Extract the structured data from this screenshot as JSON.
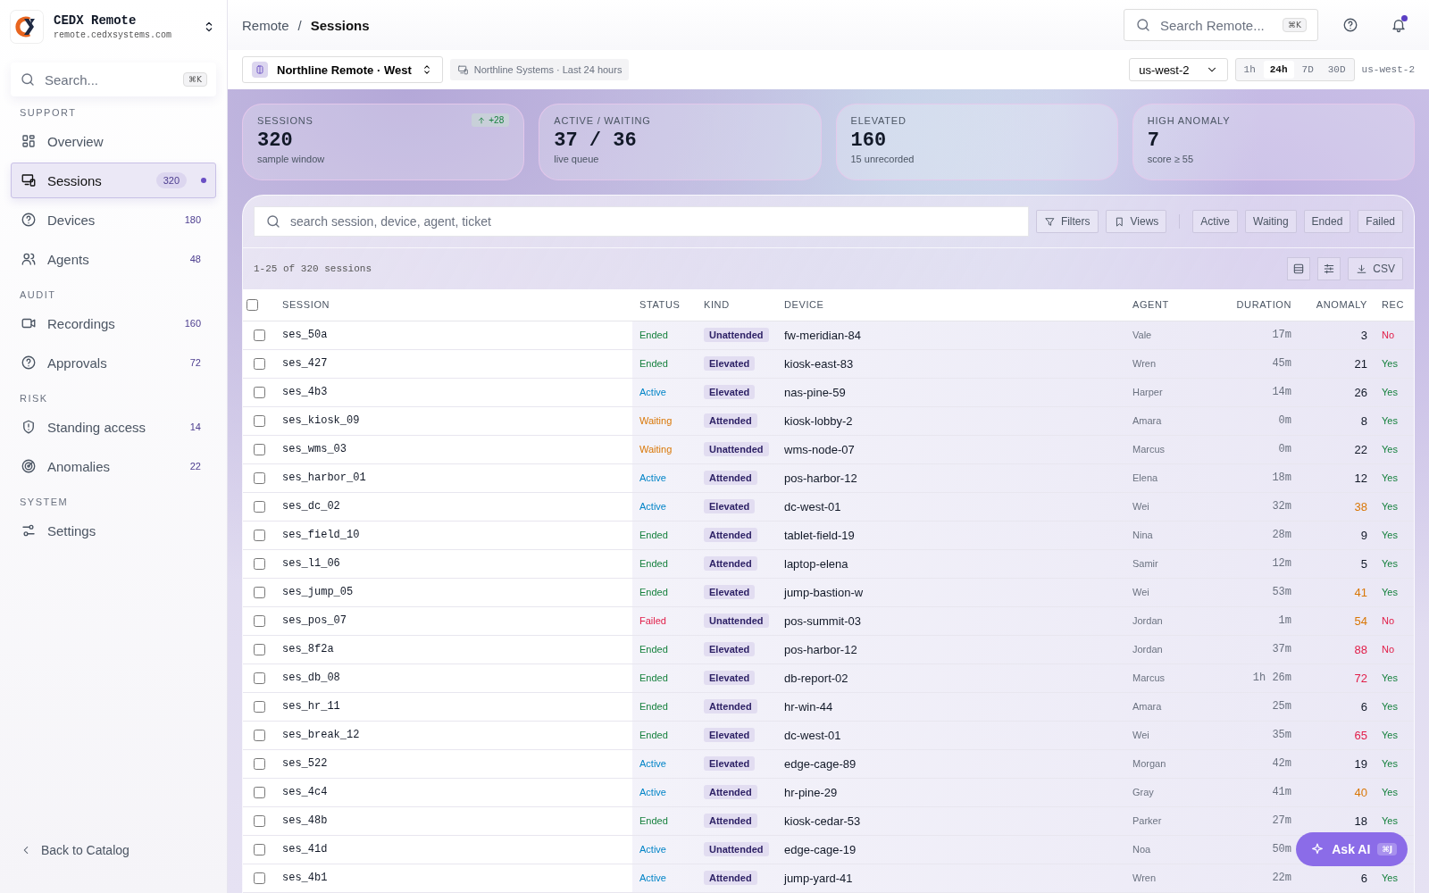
{
  "brand": {
    "title": "CEDX Remote",
    "subtitle": "remote.cedxsystems.com"
  },
  "sidebar": {
    "search": {
      "placeholder": "Search...",
      "shortcut": "⌘K"
    },
    "sections": [
      {
        "title": "SUPPORT",
        "items": [
          {
            "label": "Overview",
            "selected": false,
            "dot": false
          },
          {
            "label": "Sessions",
            "count": "320",
            "selected": true,
            "dot": true
          },
          {
            "label": "Devices",
            "count": "180",
            "selected": false,
            "dot": false
          },
          {
            "label": "Agents",
            "count": "48",
            "selected": false,
            "dot": false
          }
        ]
      },
      {
        "title": "AUDIT",
        "items": [
          {
            "label": "Recordings",
            "count": "160",
            "selected": false,
            "dot": false
          },
          {
            "label": "Approvals",
            "count": "72",
            "selected": false,
            "dot": false
          }
        ]
      },
      {
        "title": "RISK",
        "items": [
          {
            "label": "Standing access",
            "count": "14",
            "selected": false,
            "dot": false
          },
          {
            "label": "Anomalies",
            "count": "22",
            "selected": false,
            "dot": false
          }
        ]
      },
      {
        "title": "SYSTEM",
        "items": [
          {
            "label": "Settings",
            "selected": false,
            "dot": false
          }
        ]
      }
    ],
    "back": "Back to Catalog"
  },
  "header": {
    "breadcrumb": [
      "Remote",
      "Sessions"
    ],
    "breadcrumb_separator": "/",
    "search": {
      "placeholder": "Search Remote...",
      "shortcut": "⌘K"
    },
    "notifications_unread": true
  },
  "toolbar": {
    "workspace": "Northline Remote · West",
    "context": "Northline Systems · Last 24 hours",
    "region": "us-west-2",
    "ranges": [
      {
        "label": "1h",
        "selected": false
      },
      {
        "label": "24h",
        "selected": true
      },
      {
        "label": "7D",
        "selected": false
      },
      {
        "label": "30D",
        "selected": false
      }
    ],
    "region_label": "us-west-2"
  },
  "kpis": [
    {
      "label": "SESSIONS",
      "value": "320",
      "note": "sample window",
      "delta": "+28"
    },
    {
      "label": "ACTIVE / WAITING",
      "value": "37 / 36",
      "note": "live queue"
    },
    {
      "label": "ELEVATED",
      "value": "160",
      "note": "15 unrecorded"
    },
    {
      "label": "HIGH ANOMALY",
      "value": "7",
      "note": "score ≥ 55"
    }
  ],
  "table": {
    "search": {
      "placeholder": "search session, device, agent, ticket"
    },
    "buttons": [
      "Filters",
      "Views"
    ],
    "status_filters": [
      {
        "label": "Active",
        "selected": false
      },
      {
        "label": "Waiting",
        "selected": false
      },
      {
        "label": "Ended",
        "selected": false
      },
      {
        "label": "Failed",
        "selected": false
      }
    ],
    "count": "1-25 of 320 sessions",
    "export": "CSV",
    "all_selected": false,
    "columns": [
      "SESSION",
      "STATUS",
      "KIND",
      "DEVICE",
      "AGENT",
      "DURATION",
      "ANOMALY",
      "REC"
    ],
    "rows": [
      {
        "session": "ses_50a",
        "status": {
          "text": "Ended",
          "color": "#15803d"
        },
        "kind": "Unattended",
        "device": "fw-meridian-84",
        "agent": "Vale",
        "duration": "17m",
        "anomaly": {
          "text": "3",
          "color": "#111827"
        },
        "rec": "No",
        "recorded": false,
        "selected": false
      },
      {
        "session": "ses_427",
        "status": {
          "text": "Ended",
          "color": "#15803d"
        },
        "kind": "Elevated",
        "device": "kiosk-east-83",
        "agent": "Wren",
        "duration": "45m",
        "anomaly": {
          "text": "21",
          "color": "#111827"
        },
        "rec": "Yes",
        "recorded": true,
        "selected": false
      },
      {
        "session": "ses_4b3",
        "status": {
          "text": "Active",
          "color": "#0284c7"
        },
        "kind": "Elevated",
        "device": "nas-pine-59",
        "agent": "Harper",
        "duration": "14m",
        "anomaly": {
          "text": "26",
          "color": "#111827"
        },
        "rec": "Yes",
        "recorded": true,
        "selected": false
      },
      {
        "session": "ses_kiosk_09",
        "status": {
          "text": "Waiting",
          "color": "#d97706"
        },
        "kind": "Attended",
        "device": "kiosk-lobby-2",
        "agent": "Amara",
        "duration": "0m",
        "anomaly": {
          "text": "8",
          "color": "#111827"
        },
        "rec": "Yes",
        "recorded": true,
        "selected": false
      },
      {
        "session": "ses_wms_03",
        "status": {
          "text": "Waiting",
          "color": "#d97706"
        },
        "kind": "Unattended",
        "device": "wms-node-07",
        "agent": "Marcus",
        "duration": "0m",
        "anomaly": {
          "text": "22",
          "color": "#111827"
        },
        "rec": "Yes",
        "recorded": true,
        "selected": false
      },
      {
        "session": "ses_harbor_01",
        "status": {
          "text": "Active",
          "color": "#0284c7"
        },
        "kind": "Attended",
        "device": "pos-harbor-12",
        "agent": "Elena",
        "duration": "18m",
        "anomaly": {
          "text": "12",
          "color": "#111827"
        },
        "rec": "Yes",
        "recorded": true,
        "selected": false
      },
      {
        "session": "ses_dc_02",
        "status": {
          "text": "Active",
          "color": "#0284c7"
        },
        "kind": "Elevated",
        "device": "dc-west-01",
        "agent": "Wei",
        "duration": "32m",
        "anomaly": {
          "text": "38",
          "color": "#d97706"
        },
        "rec": "Yes",
        "recorded": true,
        "selected": false
      },
      {
        "session": "ses_field_10",
        "status": {
          "text": "Ended",
          "color": "#15803d"
        },
        "kind": "Attended",
        "device": "tablet-field-19",
        "agent": "Nina",
        "duration": "28m",
        "anomaly": {
          "text": "9",
          "color": "#111827"
        },
        "rec": "Yes",
        "recorded": true,
        "selected": false
      },
      {
        "session": "ses_l1_06",
        "status": {
          "text": "Ended",
          "color": "#15803d"
        },
        "kind": "Attended",
        "device": "laptop-elena",
        "agent": "Samir",
        "duration": "12m",
        "anomaly": {
          "text": "5",
          "color": "#111827"
        },
        "rec": "Yes",
        "recorded": true,
        "selected": false
      },
      {
        "session": "ses_jump_05",
        "status": {
          "text": "Ended",
          "color": "#15803d"
        },
        "kind": "Elevated",
        "device": "jump-bastion-w",
        "agent": "Wei",
        "duration": "53m",
        "anomaly": {
          "text": "41",
          "color": "#d97706"
        },
        "rec": "Yes",
        "recorded": true,
        "selected": false
      },
      {
        "session": "ses_pos_07",
        "status": {
          "text": "Failed",
          "color": "#e11d48"
        },
        "kind": "Unattended",
        "device": "pos-summit-03",
        "agent": "Jordan",
        "duration": "1m",
        "anomaly": {
          "text": "54",
          "color": "#d97706"
        },
        "rec": "No",
        "recorded": false,
        "selected": false
      },
      {
        "session": "ses_8f2a",
        "status": {
          "text": "Ended",
          "color": "#15803d"
        },
        "kind": "Elevated",
        "device": "pos-harbor-12",
        "agent": "Jordan",
        "duration": "37m",
        "anomaly": {
          "text": "88",
          "color": "#e11d48"
        },
        "rec": "No",
        "recorded": false,
        "selected": false
      },
      {
        "session": "ses_db_08",
        "status": {
          "text": "Ended",
          "color": "#15803d"
        },
        "kind": "Elevated",
        "device": "db-report-02",
        "agent": "Marcus",
        "duration": "1h 26m",
        "anomaly": {
          "text": "72",
          "color": "#e11d48"
        },
        "rec": "Yes",
        "recorded": true,
        "selected": false
      },
      {
        "session": "ses_hr_11",
        "status": {
          "text": "Ended",
          "color": "#15803d"
        },
        "kind": "Attended",
        "device": "hr-win-44",
        "agent": "Amara",
        "duration": "25m",
        "anomaly": {
          "text": "6",
          "color": "#111827"
        },
        "rec": "Yes",
        "recorded": true,
        "selected": false
      },
      {
        "session": "ses_break_12",
        "status": {
          "text": "Ended",
          "color": "#15803d"
        },
        "kind": "Elevated",
        "device": "dc-west-01",
        "agent": "Wei",
        "duration": "35m",
        "anomaly": {
          "text": "65",
          "color": "#e11d48"
        },
        "rec": "Yes",
        "recorded": true,
        "selected": false
      },
      {
        "session": "ses_522",
        "status": {
          "text": "Active",
          "color": "#0284c7"
        },
        "kind": "Elevated",
        "device": "edge-cage-89",
        "agent": "Morgan",
        "duration": "42m",
        "anomaly": {
          "text": "19",
          "color": "#111827"
        },
        "rec": "Yes",
        "recorded": true,
        "selected": false
      },
      {
        "session": "ses_4c4",
        "status": {
          "text": "Active",
          "color": "#0284c7"
        },
        "kind": "Attended",
        "device": "hr-pine-29",
        "agent": "Gray",
        "duration": "41m",
        "anomaly": {
          "text": "40",
          "color": "#d97706"
        },
        "rec": "Yes",
        "recorded": true,
        "selected": false
      },
      {
        "session": "ses_48b",
        "status": {
          "text": "Ended",
          "color": "#15803d"
        },
        "kind": "Attended",
        "device": "kiosk-cedar-53",
        "agent": "Parker",
        "duration": "27m",
        "anomaly": {
          "text": "18",
          "color": "#111827"
        },
        "rec": "Yes",
        "recorded": true,
        "selected": false
      },
      {
        "session": "ses_41d",
        "status": {
          "text": "Active",
          "color": "#0284c7"
        },
        "kind": "Unattended",
        "device": "edge-cage-19",
        "agent": "Noa",
        "duration": "50m",
        "selected": false
      },
      {
        "session": "ses_4b1",
        "status": {
          "text": "Active",
          "color": "#0284c7"
        },
        "kind": "Attended",
        "device": "jump-yard-41",
        "agent": "Wren",
        "duration": "22m",
        "anomaly": {
          "text": "6",
          "color": "#111827"
        },
        "rec": "Yes",
        "recorded": true,
        "selected": false
      }
    ]
  },
  "assistant": {
    "label": "Ask AI",
    "shortcut": "⌘J"
  }
}
